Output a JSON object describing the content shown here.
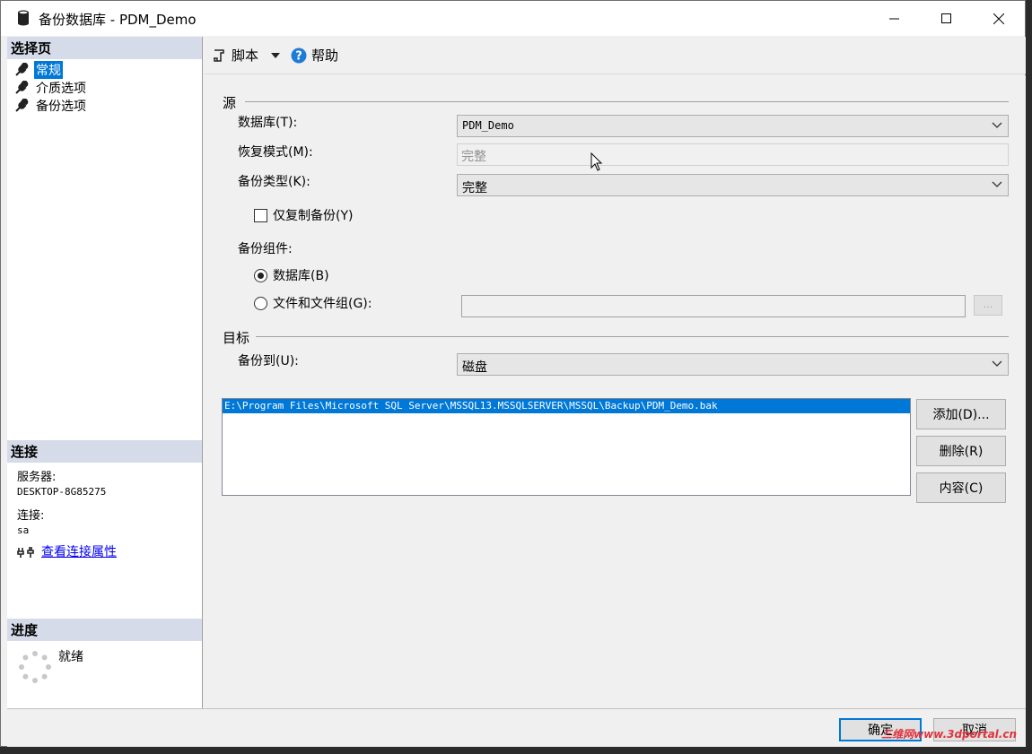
{
  "window": {
    "title": "备份数据库 - PDM_Demo"
  },
  "left": {
    "select_page_header": "选择页",
    "pages": [
      {
        "label": "常规",
        "active": true
      },
      {
        "label": "介质选项",
        "active": false
      },
      {
        "label": "备份选项",
        "active": false
      }
    ],
    "connection_header": "连接",
    "server_label": "服务器:",
    "server_value": "DESKTOP-8G85275",
    "connection_label": "连接:",
    "connection_value": "sa",
    "view_props_link": "查看连接属性",
    "progress_header": "进度",
    "progress_status": "就绪"
  },
  "toolbar": {
    "script_label": "脚本",
    "help_label": "帮助"
  },
  "source": {
    "group_title": "源",
    "database_label": "数据库(T):",
    "database_value": "PDM_Demo",
    "recovery_label": "恢复模式(M):",
    "recovery_value": "完整",
    "backup_type_label": "备份类型(K):",
    "backup_type_value": "完整",
    "copy_only_label": "仅复制备份(Y)",
    "copy_only_checked": false,
    "component_label": "备份组件:",
    "radio_database_label": "数据库(B)",
    "radio_files_label": "文件和文件组(G):",
    "browse_label": "..."
  },
  "destination": {
    "group_title": "目标",
    "backup_to_label": "备份到(U):",
    "backup_to_value": "磁盘",
    "paths": [
      "E:\\Program Files\\Microsoft SQL Server\\MSSQL13.MSSQLSERVER\\MSSQL\\Backup\\PDM_Demo.bak"
    ],
    "add_label": "添加(D)...",
    "remove_label": "删除(R)",
    "contents_label": "内容(C)"
  },
  "footer": {
    "ok_label": "确定",
    "cancel_label": "取消"
  },
  "watermark": "三维网www.3dportal.cn"
}
